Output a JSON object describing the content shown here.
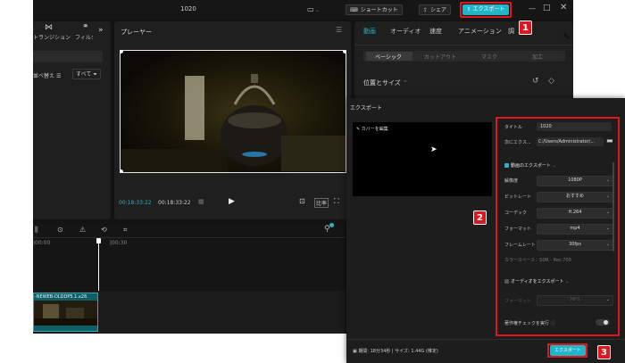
{
  "window": {
    "title": "1020"
  },
  "titlebar": {
    "shortcut_label": "ショートカット",
    "share_label": "シェア",
    "export_label": "エクスポート"
  },
  "left_panel": {
    "tab_transition": "トランジション",
    "tab_filter": "フィルタ",
    "sort_label": "並べ替え",
    "all_label": "すべて"
  },
  "player": {
    "title": "プレーヤー",
    "current_time": "00:18:33:22",
    "total_time": "00:18:33:22",
    "ratio_label": "比率"
  },
  "inspector": {
    "tabs": [
      "動画",
      "オーディオ",
      "速度",
      "アニメーション",
      "調"
    ],
    "subtabs": [
      "ベーシック",
      "カットアウト",
      "マスク",
      "加工"
    ],
    "section_title": "位置とサイズ"
  },
  "timeline": {
    "ruler_labels": [
      "|00:00",
      "|00:30"
    ],
    "clip_label": "-NEWEB-DLDDP5.1.x26"
  },
  "export_dialog": {
    "title": "エクスポート",
    "cover_edit": "カバーを編集",
    "title_label": "タイトル",
    "title_value": "1020",
    "export_to_label": "次にエクス...",
    "export_to_value": "C:/Users/Administrator/...",
    "video_section": "動画のエクスポート",
    "resolution_label": "解像度",
    "resolution_value": "1080P",
    "bitrate_label": "ビットレート",
    "bitrate_value": "おすすめ",
    "codec_label": "コーデック",
    "codec_value": "H.264",
    "format_label": "フォーマット",
    "format_value": "mp4",
    "framerate_label": "フレームレート",
    "framerate_value": "30fps",
    "colorspace": "カラースペース：SDR - Rec.709",
    "audio_section": "オーディオをエクスポート",
    "audio_format_label": "フォーマット",
    "audio_format_value": "MP3",
    "copyright_label": "著作権チェックを実行",
    "footer_info": "期間: 18分34秒 | サイズ: 1.44G (推定)",
    "export_button": "エクスポート"
  },
  "callouts": [
    "1",
    "2",
    "3"
  ],
  "colors": {
    "accent": "#1fb7c8",
    "callout_red": "#e0161e",
    "bg": "#131313"
  }
}
